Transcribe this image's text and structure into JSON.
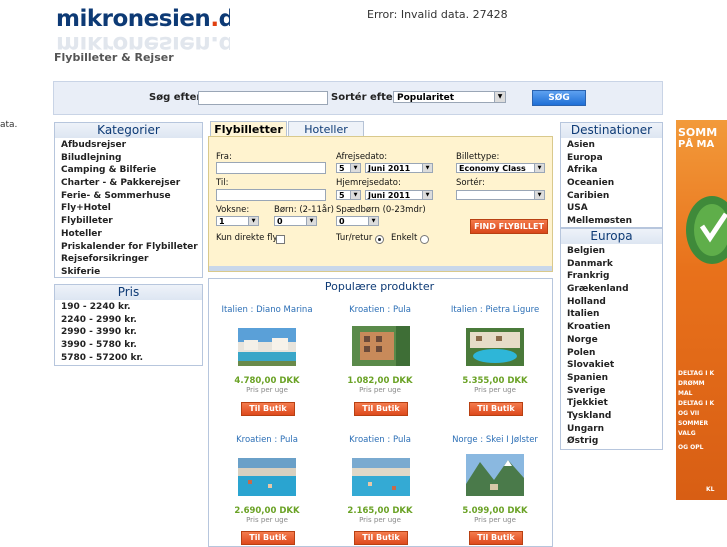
{
  "header": {
    "logo_text": "mikronesien",
    "logo_dot": ".",
    "logo_tld": "dk",
    "tagline": "Flybilleter & Rejser",
    "error": "Error: Invalid data. 27428",
    "stray_text": "ata."
  },
  "search": {
    "label": "Søg efter:",
    "value": "",
    "sort_label": "Sortér efter:",
    "sort_value": "Popularitet",
    "button": "SØG"
  },
  "kategorier": {
    "title": "Kategorier",
    "items": [
      "Afbudsrejser",
      "Biludlejning",
      "Camping & Bilferie",
      "Charter - & Pakkerejser",
      "Ferie- & Sommerhuse",
      "Fly+Hotel",
      "Flybilleter",
      "Hoteller",
      "Priskalender for Flybilleter",
      "Rejseforsikringer",
      "Skiferie"
    ]
  },
  "pris": {
    "title": "Pris",
    "items": [
      "190 - 2240 kr.",
      "2240 - 2990 kr.",
      "2990 - 3990 kr.",
      "3990 - 5780 kr.",
      "5780 - 57200 kr."
    ]
  },
  "tabs": {
    "active": "Flybilletter",
    "inactive": "Hoteller"
  },
  "form": {
    "fra": "Fra:",
    "til": "Til:",
    "afrejse": "Afrejsedato:",
    "hjemrejse": "Hjemrejsedato:",
    "afrejse_day": "5",
    "afrejse_month": "Juni 2011",
    "hjemrejse_day": "5",
    "hjemrejse_month": "Juni 2011",
    "billettype_label": "Billettype:",
    "billettype_value": "Economy Class",
    "sorter_label": "Sortér:",
    "voksne_label": "Voksne:",
    "voksne_value": "1",
    "born_label": "Børn: (2-11år)",
    "born_value": "0",
    "spaedborn_label": "Spædbørn (0-23mdr)",
    "spaedborn_value": "0",
    "direkte_label": "Kun direkte fly",
    "turretur_label": "Tur/retur",
    "enkelt_label": "Enkelt",
    "find_button": "FIND FLYBILLET"
  },
  "popular": {
    "title": "Populære produkter",
    "per_week": "Pris per uge",
    "button": "Til Butik",
    "products": [
      {
        "title": "Italien : Diano Marina",
        "price": "4.780,00 DKK"
      },
      {
        "title": "Kroatien : Pula",
        "price": "1.082,00 DKK"
      },
      {
        "title": "Italien : Pietra Ligure",
        "price": "5.355,00 DKK"
      },
      {
        "title": "Kroatien : Pula",
        "price": "2.690,00 DKK"
      },
      {
        "title": "Kroatien : Pula",
        "price": "2.165,00 DKK"
      },
      {
        "title": "Norge : Skei I Jølster",
        "price": "5.099,00 DKK"
      }
    ]
  },
  "destinationer": {
    "title": "Destinationer",
    "items": [
      "Asien",
      "Europa",
      "Afrika",
      "Oceanien",
      "Caribien",
      "USA",
      "Mellemøsten"
    ]
  },
  "europa": {
    "title": "Europa",
    "items": [
      "Belgien",
      "Danmark",
      "Frankrig",
      "Grækenland",
      "Holland",
      "Italien",
      "Kroatien",
      "Norge",
      "Polen",
      "Slovakiet",
      "Spanien",
      "Sverige",
      "Tjekkiet",
      "Tyskland",
      "Ungarn",
      "Østrig"
    ]
  },
  "ad": {
    "lines": [
      "SOMM",
      "PÅ MA",
      "DELTAG I K",
      "DRØMM",
      "MAL",
      "DELTAG I K",
      "OG VII",
      "SOMMER",
      "VALG",
      "OG OPL",
      "KL"
    ]
  }
}
